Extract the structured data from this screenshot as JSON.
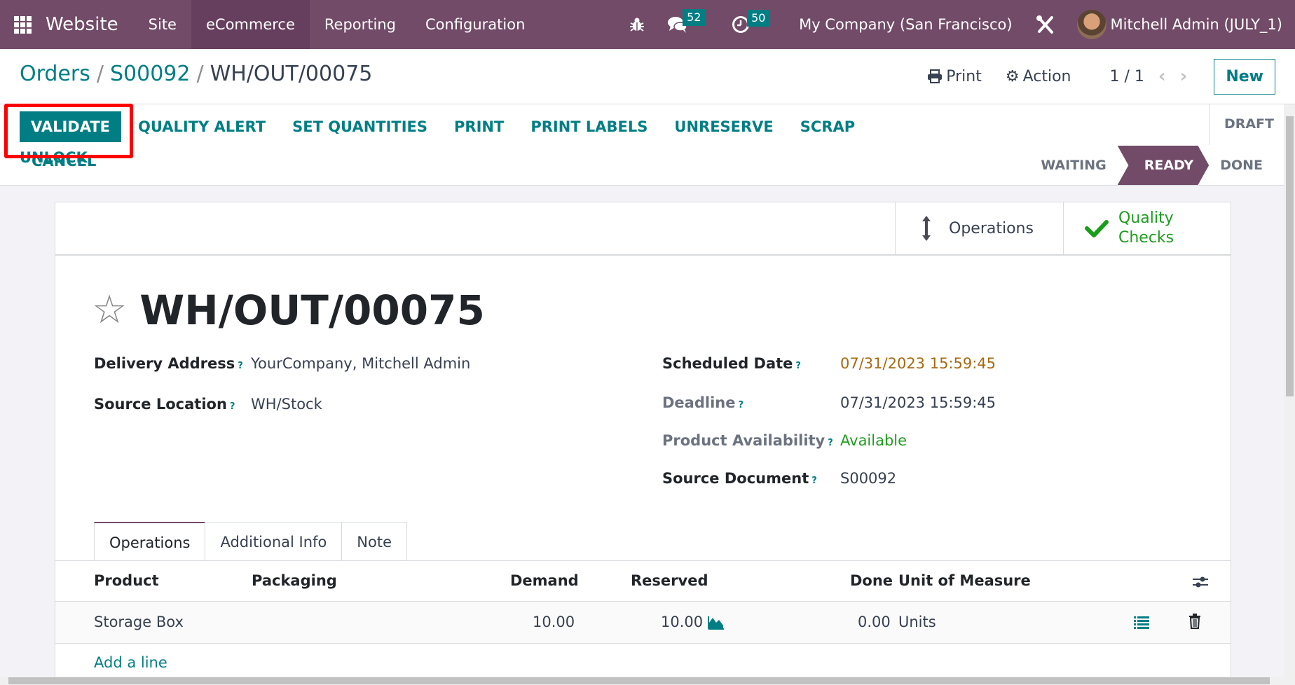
{
  "navbar": {
    "app_name": "Website",
    "menus": [
      "Site",
      "eCommerce",
      "Reporting",
      "Configuration"
    ],
    "active_menu": "eCommerce",
    "messages_badge": "52",
    "activities_badge": "50",
    "company": "My Company (San Francisco)",
    "user": "Mitchell Admin (JULY_1)"
  },
  "breadcrumb": {
    "items": [
      "Orders",
      "S00092"
    ],
    "current": "WH/OUT/00075"
  },
  "control_panel": {
    "print_label": "Print",
    "action_label": "Action",
    "pager": "1 / 1",
    "new_label": "New"
  },
  "toolbar": {
    "buttons": [
      "VALIDATE",
      "QUALITY ALERT",
      "SET QUANTITIES",
      "PRINT",
      "PRINT LABELS",
      "UNRESERVE",
      "SCRAP",
      "UNLOCK"
    ],
    "cancel_label": "CANCEL"
  },
  "status": {
    "draft": "DRAFT",
    "stages": [
      "WAITING",
      "READY",
      "DONE"
    ],
    "current": "READY"
  },
  "smart_buttons": {
    "operations": "Operations",
    "quality_checks_line1": "Quality",
    "quality_checks_line2": "Checks"
  },
  "record": {
    "title": "WH/OUT/00075",
    "fields_left": [
      {
        "label": "Delivery Address",
        "value": "YourCompany, Mitchell Admin"
      },
      {
        "label": "Source Location",
        "value": "WH/Stock"
      }
    ],
    "fields_right": [
      {
        "label": "Scheduled Date",
        "value": "07/31/2023 15:59:45",
        "color": "#a8690f"
      },
      {
        "label": "Deadline",
        "value": "07/31/2023 15:59:45"
      },
      {
        "label": "Product Availability",
        "value": "Available",
        "color": "#28a745"
      },
      {
        "label": "Source Document",
        "value": "S00092"
      }
    ],
    "help_mark": "?"
  },
  "tabs": [
    "Operations",
    "Additional Info",
    "Note"
  ],
  "active_tab": "Operations",
  "table": {
    "columns": [
      "Product",
      "Packaging",
      "Demand",
      "Reserved",
      "Done",
      "Unit of Measure"
    ],
    "rows": [
      {
        "product": "Storage Box",
        "packaging": "",
        "demand": "10.00",
        "reserved": "10.00",
        "done": "0.00",
        "uom": "Units"
      }
    ],
    "add_line": "Add a line"
  },
  "colors": {
    "brand": "#714b67",
    "accent": "#017e84",
    "highlight": "#ff0000"
  }
}
